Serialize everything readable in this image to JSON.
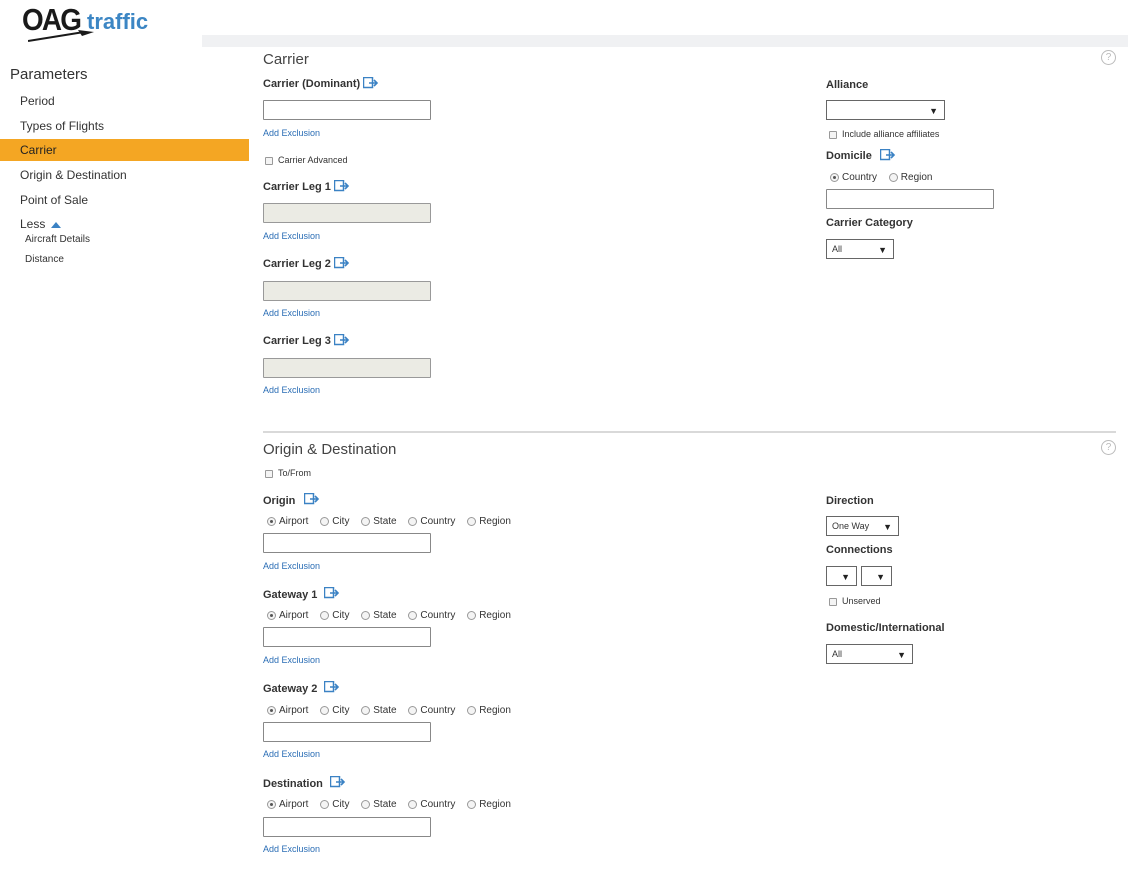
{
  "logo": {
    "brand": "OAG",
    "product": "traffic"
  },
  "sidebar": {
    "title": "Parameters",
    "items": [
      {
        "label": "Period"
      },
      {
        "label": "Types of Flights"
      },
      {
        "label": "Carrier"
      },
      {
        "label": "Origin & Destination"
      },
      {
        "label": "Point of Sale"
      },
      {
        "label": "Less"
      }
    ],
    "sub_items": [
      {
        "label": "Aircraft Details"
      },
      {
        "label": "Distance"
      }
    ]
  },
  "carrier_section": {
    "title": "Carrier",
    "dominant_label": "Carrier (Dominant)",
    "add_exclusion": "Add Exclusion",
    "advanced_label": "Carrier Advanced",
    "leg1_label": "Carrier Leg 1",
    "leg2_label": "Carrier Leg 2",
    "leg3_label": "Carrier Leg 3",
    "alliance_label": "Alliance",
    "alliance_value": "",
    "affiliates_label": "Include alliance affiliates",
    "domicile_label": "Domicile",
    "domicile_options": [
      "Country",
      "Region"
    ],
    "category_label": "Carrier Category",
    "category_value": "All"
  },
  "od_section": {
    "title": "Origin & Destination",
    "tofrom_label": "To/From",
    "origin_label": "Origin",
    "gateway1_label": "Gateway 1",
    "gateway2_label": "Gateway 2",
    "destination_label": "Destination",
    "location_options": [
      "Airport",
      "City",
      "State",
      "Country",
      "Region"
    ],
    "add_exclusion": "Add Exclusion",
    "direction_label": "Direction",
    "direction_value": "One Way",
    "connections_label": "Connections",
    "unserved_label": "Unserved",
    "domestic_label": "Domestic/International",
    "domestic_value": "All"
  },
  "help_glyph": "?",
  "colors": {
    "accent": "#f4a623",
    "link": "#2a6db5",
    "icon": "#3b82c4"
  }
}
